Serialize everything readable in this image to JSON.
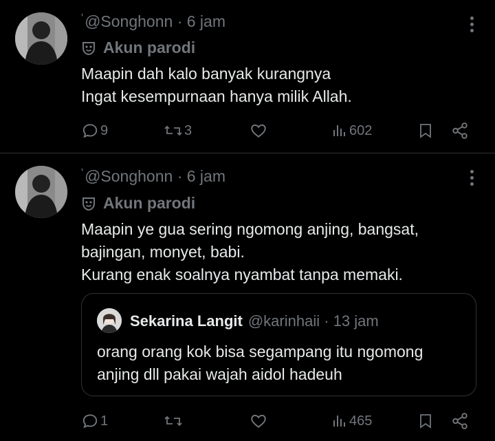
{
  "tweets": [
    {
      "handle": "@Songhonn",
      "separator": "·",
      "time": "6 jam",
      "parody_label": "Akun parodi",
      "lines": [
        "Maapin dah kalo banyak kurangnya",
        "Ingat kesempurnaan hanya milik Allah."
      ],
      "replies": "9",
      "reposts": "3",
      "likes": "",
      "views": "602"
    },
    {
      "handle": "@Songhonn",
      "separator": "·",
      "time": "6 jam",
      "parody_label": "Akun parodi",
      "lines": [
        "Maapin ye gua sering ngomong anjing, bangsat,",
        "bajingan, monyet, babi.",
        "Kurang enak soalnya nyambat tanpa memaki."
      ],
      "quote": {
        "name": "Sekarina Langit",
        "handle": "@karinhaii",
        "separator": "·",
        "time": "13 jam",
        "lines": [
          "orang orang kok bisa segampang itu ngomong",
          "anjing dll pakai wajah aidol hadeuh"
        ]
      },
      "replies": "1",
      "reposts": "",
      "likes": "",
      "views": "465"
    }
  ],
  "colors": {
    "background": "#000000",
    "text": "#e7e9ea",
    "muted": "#71767b",
    "border": "#2f3336"
  },
  "icons": [
    "reply-icon",
    "repost-icon",
    "like-icon",
    "views-icon",
    "bookmark-icon",
    "share-icon",
    "more-icon",
    "parody-mask-icon"
  ]
}
